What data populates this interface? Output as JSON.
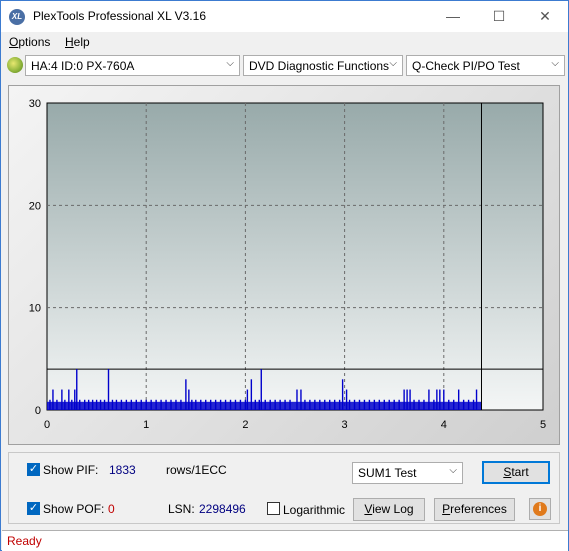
{
  "window": {
    "title": "PlexTools Professional XL V3.16",
    "icon_text": "XL"
  },
  "window_controls": {
    "minimize": "—",
    "maximize": "☐",
    "close": "✕"
  },
  "menu": {
    "options_first": "O",
    "options_rest": "ptions",
    "help_first": "H",
    "help_rest": "elp"
  },
  "toolbar": {
    "drive": "HA:4 ID:0  PX-760A",
    "category": "DVD Diagnostic Functions",
    "test": "Q-Check PI/PO Test",
    "chevron": "⌵"
  },
  "chart_data": {
    "type": "bar",
    "xlim": [
      0,
      5
    ],
    "ylim": [
      0,
      30
    ],
    "x_ticks": [
      "0",
      "1",
      "2",
      "3",
      "4",
      "5"
    ],
    "y_ticks": [
      "0",
      "10",
      "20",
      "30"
    ],
    "grid": true,
    "threshold": 4,
    "scan_end": 4.38,
    "series": [
      {
        "color": "#0000cc",
        "points": [
          [
            0.03,
            1
          ],
          [
            0.06,
            2
          ],
          [
            0.1,
            1
          ],
          [
            0.15,
            2
          ],
          [
            0.18,
            1
          ],
          [
            0.22,
            2
          ],
          [
            0.25,
            1
          ],
          [
            0.28,
            2
          ],
          [
            0.3,
            4
          ],
          [
            0.33,
            1
          ],
          [
            0.38,
            1
          ],
          [
            0.42,
            1
          ],
          [
            0.46,
            1
          ],
          [
            0.5,
            1
          ],
          [
            0.54,
            1
          ],
          [
            0.58,
            1
          ],
          [
            0.62,
            4
          ],
          [
            0.66,
            1
          ],
          [
            0.7,
            1
          ],
          [
            0.75,
            1
          ],
          [
            0.8,
            1
          ],
          [
            0.85,
            1
          ],
          [
            0.9,
            1
          ],
          [
            0.95,
            1
          ],
          [
            1.0,
            1
          ],
          [
            1.05,
            1
          ],
          [
            1.1,
            1
          ],
          [
            1.15,
            1
          ],
          [
            1.2,
            1
          ],
          [
            1.25,
            1
          ],
          [
            1.3,
            1
          ],
          [
            1.35,
            1
          ],
          [
            1.4,
            3
          ],
          [
            1.43,
            2
          ],
          [
            1.46,
            1
          ],
          [
            1.5,
            1
          ],
          [
            1.55,
            1
          ],
          [
            1.6,
            1
          ],
          [
            1.65,
            1
          ],
          [
            1.7,
            1
          ],
          [
            1.75,
            1
          ],
          [
            1.8,
            1
          ],
          [
            1.85,
            1
          ],
          [
            1.9,
            1
          ],
          [
            1.95,
            1
          ],
          [
            2.0,
            1
          ],
          [
            2.02,
            2
          ],
          [
            2.06,
            3
          ],
          [
            2.1,
            1
          ],
          [
            2.14,
            1
          ],
          [
            2.16,
            4
          ],
          [
            2.2,
            1
          ],
          [
            2.25,
            1
          ],
          [
            2.3,
            1
          ],
          [
            2.35,
            1
          ],
          [
            2.4,
            1
          ],
          [
            2.45,
            1
          ],
          [
            2.52,
            2
          ],
          [
            2.56,
            2
          ],
          [
            2.6,
            1
          ],
          [
            2.65,
            1
          ],
          [
            2.7,
            1
          ],
          [
            2.75,
            1
          ],
          [
            2.8,
            1
          ],
          [
            2.85,
            1
          ],
          [
            2.9,
            1
          ],
          [
            2.95,
            1
          ],
          [
            2.98,
            3
          ],
          [
            3.02,
            2
          ],
          [
            3.05,
            1
          ],
          [
            3.1,
            1
          ],
          [
            3.15,
            1
          ],
          [
            3.2,
            1
          ],
          [
            3.25,
            1
          ],
          [
            3.3,
            1
          ],
          [
            3.35,
            1
          ],
          [
            3.4,
            1
          ],
          [
            3.45,
            1
          ],
          [
            3.5,
            1
          ],
          [
            3.55,
            1
          ],
          [
            3.6,
            2
          ],
          [
            3.63,
            2
          ],
          [
            3.66,
            2
          ],
          [
            3.7,
            1
          ],
          [
            3.75,
            1
          ],
          [
            3.8,
            1
          ],
          [
            3.85,
            2
          ],
          [
            3.9,
            1
          ],
          [
            3.93,
            2
          ],
          [
            3.96,
            2
          ],
          [
            4.0,
            2
          ],
          [
            4.05,
            1
          ],
          [
            4.1,
            1
          ],
          [
            4.15,
            2
          ],
          [
            4.2,
            1
          ],
          [
            4.25,
            1
          ],
          [
            4.3,
            1
          ],
          [
            4.33,
            2
          ]
        ]
      }
    ]
  },
  "controls": {
    "show_pif_label": "Show PIF:",
    "pif_value": "1833",
    "pif_unit": "rows/1ECC",
    "show_pof_label": "Show POF:",
    "pof_value": "0",
    "lsn_label": "LSN:",
    "lsn_value": "2298496",
    "logarithmic_label": "Logarithmic",
    "sum_select": "SUM1 Test",
    "start_first": "S",
    "start_rest": "tart",
    "viewlog_first": "V",
    "viewlog_rest": "iew Log",
    "prefs_first": "P",
    "prefs_rest": "references",
    "info_glyph": "i",
    "check_glyph": "✓"
  },
  "status": {
    "text": "Ready"
  }
}
